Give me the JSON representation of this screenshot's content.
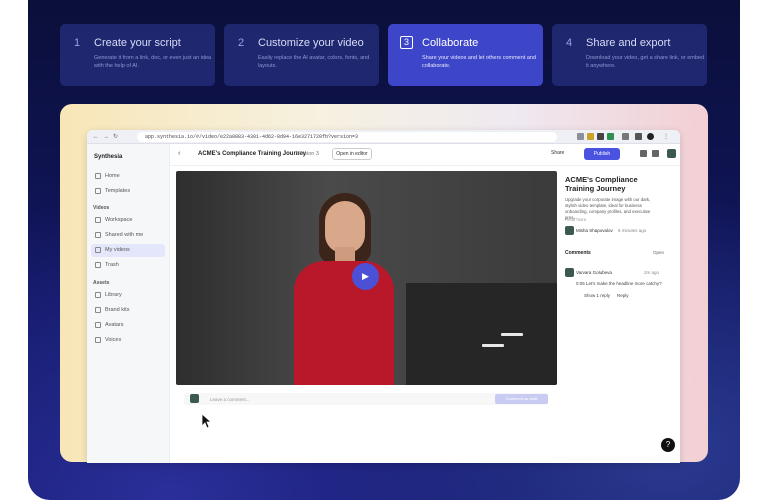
{
  "steps": [
    {
      "num": "1",
      "title": "Create your script",
      "desc": "Generate it from a link, doc, or even just an idea with the help of AI."
    },
    {
      "num": "2",
      "title": "Customize your video",
      "desc": "Easily replace the AI avatar, colors, fonts, and layouts."
    },
    {
      "num": "3",
      "title": "Collaborate",
      "desc": "Share your videos and let others comment and collaborate."
    },
    {
      "num": "4",
      "title": "Share and export",
      "desc": "Download your video, get a share link, or embed it anywhere."
    }
  ],
  "browser": {
    "url": "app.synthesia.io/#/video/e22a0883-4301-4d62-8d94-16e3271720fb?version=3"
  },
  "sidebar": {
    "brand": "Synthesia",
    "items_top": [
      "Home",
      "Templates"
    ],
    "videos_heading": "Videos",
    "items_videos": [
      "Workspace",
      "Shared with me",
      "My videos",
      "Trash"
    ],
    "assets_heading": "Assets",
    "items_assets": [
      "Library",
      "Brand kits",
      "Avatars",
      "Voices"
    ]
  },
  "topbar": {
    "back": "‹",
    "title": "ACME's Compliance Training Journey",
    "version": "Version 3",
    "open_editor": "Open in editor",
    "share": "Share",
    "publish": "Publish"
  },
  "comment_input": {
    "placeholder": "Leave a comment...",
    "button": "Comment as draft"
  },
  "panel": {
    "title": "ACME's Compliance Training Journey",
    "desc": "Upgrade your corporate image with our dark, stylish video template, ideal for business onboarding, company profiles, and executive pres...",
    "read_more": "Read more",
    "author": "Misha Shapovalov",
    "time": "5 minutes ago",
    "comments_heading": "Comments",
    "comments_filter": "Open",
    "comment": {
      "author": "Varvara Golubeva",
      "time": "2m ago",
      "text": "0:05 Let's make the headline more catchy?",
      "show_reply": "Show 1 reply",
      "reply": "Reply"
    }
  },
  "help": "?"
}
